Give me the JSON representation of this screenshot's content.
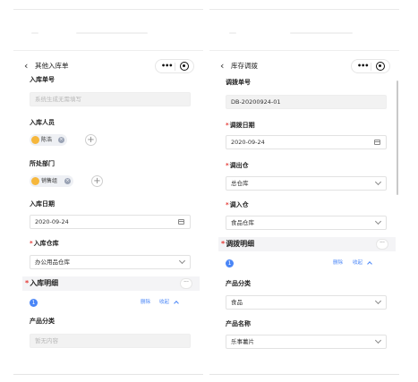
{
  "left": {
    "nav_title": "其他入库单",
    "back_glyph": "‹",
    "more_glyph": "•••",
    "fields": {
      "doc_no_label": "入库单号",
      "doc_no_placeholder": "系统生成无需填写",
      "person_label": "入库人员",
      "person_tag": "陈浩",
      "dept_label": "所处部门",
      "dept_tag": "销售组",
      "date_label": "入库日期",
      "date_value": "2020-09-24",
      "warehouse_required": "*",
      "warehouse_label": "入库仓库",
      "warehouse_value": "办公用品仓库"
    },
    "section": {
      "required": "*",
      "title": "入库明细",
      "more": "···"
    },
    "item": {
      "index": "1",
      "delete": "删除",
      "collapse": "收起"
    },
    "category_label": "产品分类",
    "category_placeholder": "暂无内容"
  },
  "right": {
    "nav_title": "库存调拨",
    "back_glyph": "‹",
    "more_glyph": "•••",
    "fields": {
      "doc_no_label": "调拨单号",
      "doc_no_value": "DB-20200924-01",
      "date_required": "*",
      "date_label": "调拨日期",
      "date_value": "2020-09-24",
      "out_required": "*",
      "out_label": "调出仓",
      "out_value": "总仓库",
      "in_required": "*",
      "in_label": "调入仓",
      "in_value": "食品仓库"
    },
    "section": {
      "required": "*",
      "title": "调拨明细",
      "more": "···"
    },
    "item": {
      "index": "1",
      "delete": "删除",
      "collapse": "收起"
    },
    "category_label": "产品分类",
    "category_value": "食品",
    "product_label": "产品名称",
    "product_value": "乐事薯片"
  },
  "colors": {
    "accent": "#4a86f7",
    "required": "#e53935",
    "avatar": "#f6b73c"
  },
  "icons": [
    "back-icon",
    "more-dots-icon",
    "target-icon",
    "calendar-icon",
    "chevron-down-icon",
    "plus-icon",
    "remove-tag-icon"
  ]
}
